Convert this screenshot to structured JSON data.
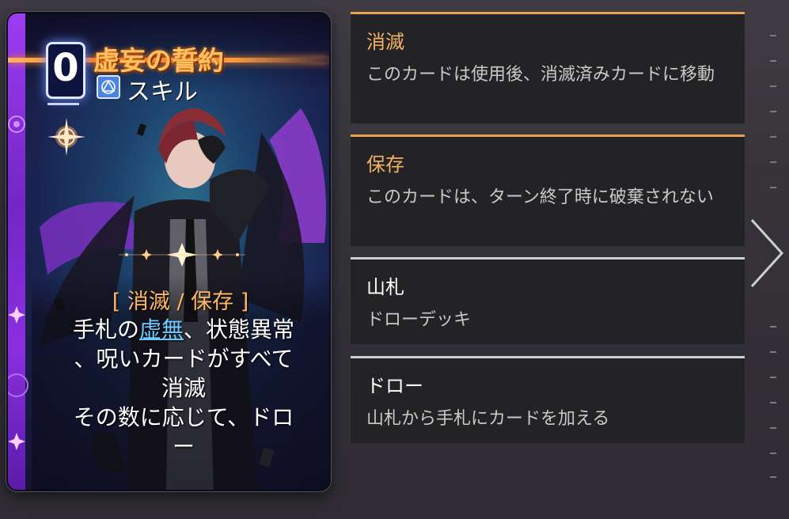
{
  "card": {
    "cost": "0",
    "title": "虚妄の誓約",
    "type_icon": "skill-type-icon",
    "type_label": "スキル",
    "keywords": "[ 消滅 / 保存 ]",
    "desc_pre": "手札の",
    "desc_kw": "虚無",
    "desc_post": "、状態異常",
    "desc_line2": "、呪いカードがすべて",
    "desc_line3": "消滅",
    "desc_line4": "その数に応じて、ドロ",
    "desc_line5": "ー"
  },
  "keyword_tooltips": [
    {
      "title": "消滅",
      "text": "このカードは使用後、消滅済みカードに移動",
      "accent": "#e9a24f"
    },
    {
      "title": "保存",
      "text": "このカードは、ターン終了時に破棄されない",
      "accent": "#e9a24f"
    },
    {
      "title": "山札",
      "text": "ドローデッキ",
      "accent": "#cfcfcf"
    },
    {
      "title": "ドロー",
      "text": "山札から手札にカードを加える",
      "accent": "#cfcfcf"
    }
  ],
  "nav": {
    "next_icon": "chevron-right-icon"
  }
}
